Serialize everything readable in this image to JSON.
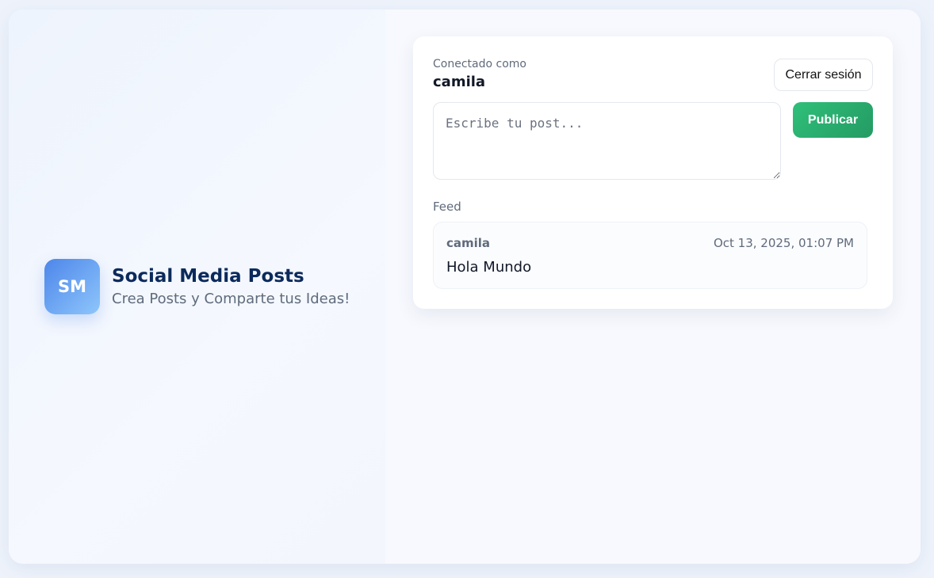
{
  "brand": {
    "logo_text": "SM",
    "title": "Social Media Posts",
    "subtitle": "Crea Posts y Comparte tus Ideas!"
  },
  "session": {
    "connected_label": "Conectado como",
    "username": "camila",
    "logout_label": "Cerrar sesión"
  },
  "composer": {
    "placeholder": "Escribe tu post...",
    "value": "",
    "publish_label": "Publicar"
  },
  "feed": {
    "label": "Feed",
    "posts": [
      {
        "author": "camila",
        "timestamp": "Oct 13, 2025, 01:07 PM",
        "body": "Hola Mundo"
      }
    ]
  },
  "colors": {
    "brand_title": "#0b2a5c",
    "publish_button": "#2fbf7a",
    "logo_gradient_start": "#4d86ea",
    "logo_gradient_end": "#8ec6fb"
  }
}
